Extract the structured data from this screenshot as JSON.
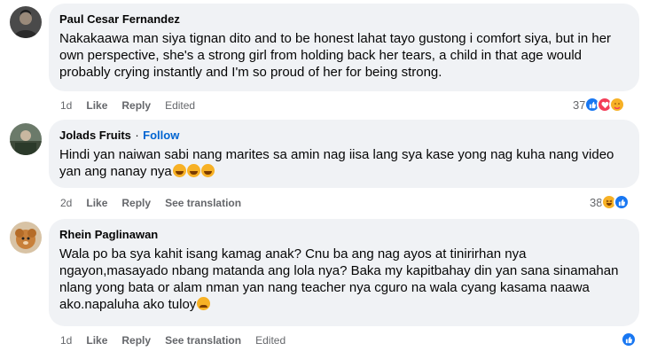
{
  "comments": [
    {
      "author": "Paul Cesar Fernandez",
      "text": "Nakakaawa man siya tignan dito and to be honest lahat tayo gustong i comfort siya, but in her own perspective, she's a strong girl from holding back her tears, a child in that age would probably crying instantly and I'm so proud of her for being strong.",
      "time": "1d",
      "like_label": "Like",
      "reply_label": "Reply",
      "edited_label": "Edited",
      "reaction_count": "37",
      "reactions": [
        "like-icon",
        "love-icon",
        "care-icon"
      ]
    },
    {
      "author": "Jolads Fruits",
      "follow_label": "Follow",
      "separator": "·",
      "text": "Hindi yan naiwan sabi nang marites sa amin nag iisa lang sya kase yong nag kuha nang video yan ang nanay nya",
      "text_emojis": [
        "haha-emoji",
        "haha-emoji",
        "haha-emoji"
      ],
      "time": "2d",
      "like_label": "Like",
      "reply_label": "Reply",
      "translate_label": "See translation",
      "reaction_count": "38",
      "reactions": [
        "haha-icon",
        "like-icon"
      ]
    },
    {
      "author": "Rhein Paglinawan",
      "text": "Wala po ba sya kahit isang kamag anak? Cnu ba ang nag ayos at tinirirhan nya ngayon,masayado nbang matanda ang lola nya? Baka my kapitbahay din yan sana sinamahan nlang yong bata or alam nman yan nang teacher nya cguro na wala cyang kasama naawa ako.napaluha ako tuloy",
      "text_emojis": [
        "sad-emoji"
      ],
      "time": "1d",
      "like_label": "Like",
      "reply_label": "Reply",
      "translate_label": "See translation",
      "edited_label": "Edited",
      "reactions": [
        "like-icon"
      ]
    }
  ],
  "colors": {
    "bubble": "#f0f2f5",
    "meta": "#65676b",
    "follow": "#0064d1",
    "like": "#1877f2",
    "love": "#f33e58",
    "haha": "#f7b125"
  }
}
